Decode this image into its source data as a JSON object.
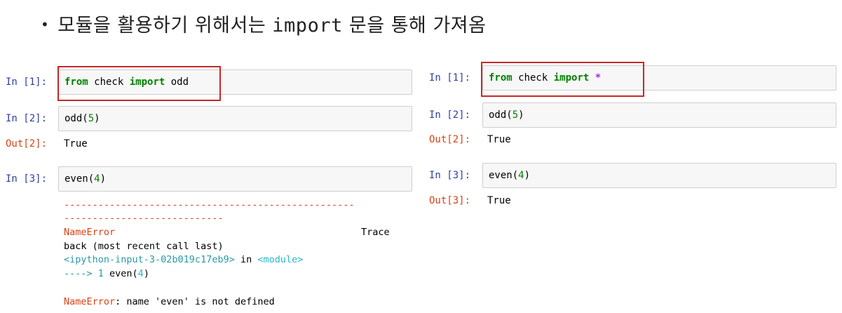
{
  "heading": {
    "bullet": "•",
    "text_before": "모듈을 활용하기 위해서는 ",
    "code": "import",
    "text_after": " 문을 통해 가져옴"
  },
  "left_notebook": {
    "cell1": {
      "prompt": "In [1]:",
      "kw_from": "from",
      "module": " check ",
      "kw_import": "import",
      "name": " odd"
    },
    "cell2": {
      "prompt": "In [2]:",
      "func": "odd(",
      "arg": "5",
      "close": ")"
    },
    "out2": {
      "prompt": "Out[2]:",
      "value": "True"
    },
    "cell3": {
      "prompt": "In [3]:",
      "func": "even(",
      "arg": "4",
      "close": ")"
    },
    "traceback": {
      "dash1": "---------------------------------------------------",
      "dash2": "----------------------------",
      "error_name": "NameError",
      "trace_tail": "Trace",
      "line2": "back (most recent call last)",
      "input_ref": "<ipython-input-3-02b019c17eb9>",
      "in_word": " in ",
      "module_ref": "<module>",
      "arrow": "----> 1 ",
      "arrow_code": "even(",
      "arrow_arg": "4",
      "arrow_close": ")",
      "final_name": "NameError",
      "final_msg": ": name 'even' is not defined"
    }
  },
  "right_notebook": {
    "cell1": {
      "prompt": "In [1]:",
      "kw_from": "from",
      "module": " check ",
      "kw_import": "import",
      "star": " *"
    },
    "cell2": {
      "prompt": "In [2]:",
      "func": "odd(",
      "arg": "5",
      "close": ")"
    },
    "out2": {
      "prompt": "Out[2]:",
      "value": "True"
    },
    "cell3": {
      "prompt": "In [3]:",
      "func": "even(",
      "arg": "4",
      "close": ")"
    },
    "out3": {
      "prompt": "Out[3]:",
      "value": "True"
    }
  },
  "colors": {
    "in_prompt": "#303f9f",
    "out_prompt": "#d84315",
    "keyword": "#008000",
    "highlight_box": "#c62828"
  }
}
